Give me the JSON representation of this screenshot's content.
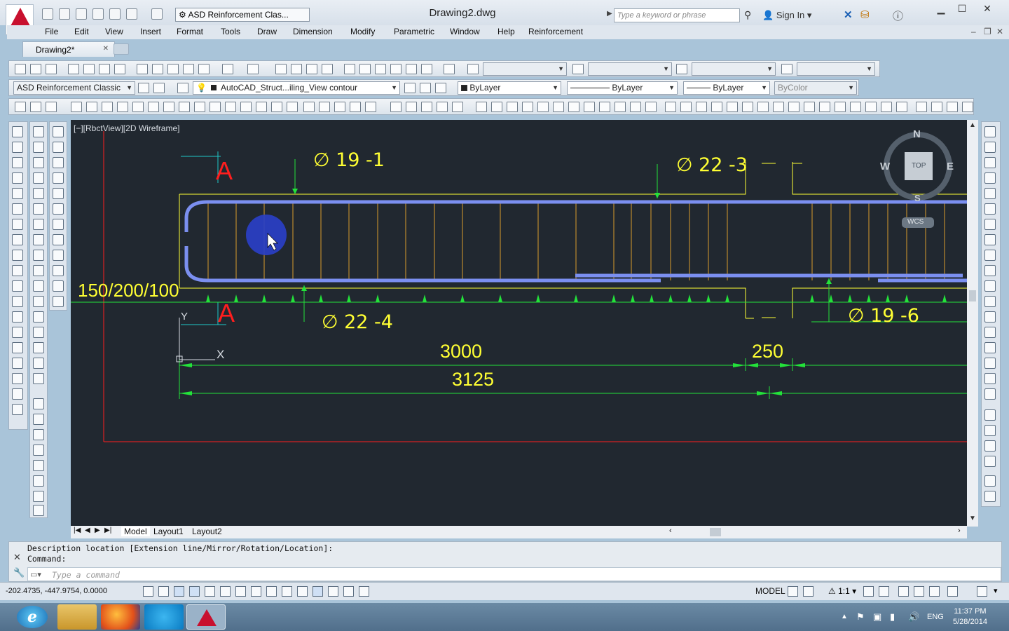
{
  "window": {
    "title": "Drawing2.dwg",
    "workspace": "ASD Reinforcement Clas...",
    "search_placeholder": "Type a keyword or phrase",
    "sign_in": "Sign In"
  },
  "menu": [
    "File",
    "Edit",
    "View",
    "Insert",
    "Format",
    "Tools",
    "Draw",
    "Dimension",
    "Modify",
    "Parametric",
    "Window",
    "Help",
    "Reinforcement"
  ],
  "file_tab": "Drawing2*",
  "toolbars": {
    "workspace_combo": "ASD Reinforcement Classic",
    "layer_combo": "AutoCAD_Struct...iling_View contour",
    "color_combo": "ByLayer",
    "linetype_combo": "ByLayer",
    "lineweight_combo": "ByLayer",
    "plotstyle_combo": "ByColor"
  },
  "viewport": {
    "label": "[−][RbctView][2D Wireframe]",
    "section_mark": "A",
    "ucs_y": "Y",
    "ucs_x": "X",
    "bar_labels": [
      "∅ 19 -1",
      "∅ 22 -3",
      "∅ 22 -4",
      "∅ 19 -6"
    ],
    "spacing_label": "150/200/100",
    "dims": [
      "3000",
      "250",
      "3125"
    ],
    "viewcube": {
      "n": "N",
      "s": "S",
      "e": "E",
      "w": "W",
      "top": "TOP",
      "wcs": "WCS"
    }
  },
  "layouts": [
    "Model",
    "Layout1",
    "Layout2"
  ],
  "command": {
    "history_1": "Description location [Extension line/Mirror/Rotation/Location]:",
    "history_2": "Command:",
    "placeholder": "Type a command"
  },
  "status": {
    "coords": "-202.4735, -447.9754, 0.0000",
    "model": "MODEL",
    "scale": "1:1"
  },
  "taskbar": {
    "time": "11:37 PM",
    "date": "5/28/2014",
    "lang": "ENG"
  },
  "colors": {
    "canvas": "#212830",
    "rebar": "#7b8ff0",
    "dim": "#23e23a",
    "label": "#ffff33",
    "red": "#ff1e1e",
    "orange_line": "#d99b2b"
  }
}
